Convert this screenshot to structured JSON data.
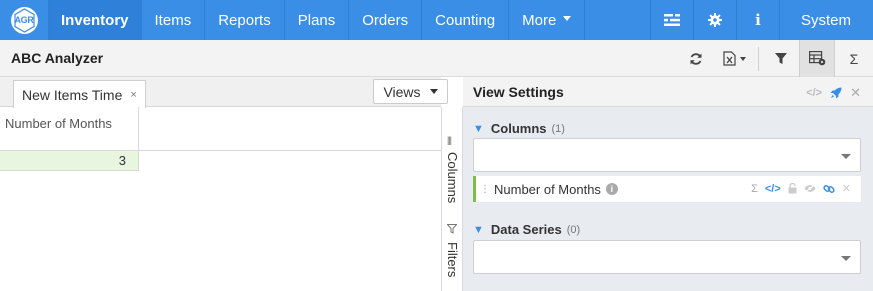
{
  "nav": {
    "logo": "AGR",
    "items": [
      {
        "label": "Inventory"
      },
      {
        "label": "Items"
      },
      {
        "label": "Reports"
      },
      {
        "label": "Plans"
      },
      {
        "label": "Orders"
      },
      {
        "label": "Counting"
      },
      {
        "label": "More"
      }
    ],
    "icons": [
      "list-icon",
      "gear-icon",
      "info-icon"
    ],
    "system_label": "System"
  },
  "titlebar": {
    "title": "ABC Analyzer",
    "icons": [
      "refresh-icon",
      "excel-export-icon",
      "filter-icon",
      "grid-settings-icon",
      "sigma-icon"
    ]
  },
  "tabs": {
    "active_tab": "New Items Time",
    "close": "×",
    "views_label": "Views"
  },
  "grid": {
    "column_header": "Number of Months",
    "rows": [
      {
        "value": "3"
      }
    ]
  },
  "sidestrip": {
    "columns_label": "Columns",
    "filters_label": "Filters"
  },
  "view_settings": {
    "title": "View Settings",
    "columns_section": {
      "label": "Columns",
      "count": "(1)"
    },
    "column_item": {
      "label": "Number of Months"
    },
    "data_series_section": {
      "label": "Data Series",
      "count": "(0)"
    }
  },
  "colors": {
    "nav_bg": "#3a8ee6",
    "accent": "#3a8ee6",
    "row_highlight": "#e8f6e0",
    "column_marker": "#7cc04b"
  }
}
